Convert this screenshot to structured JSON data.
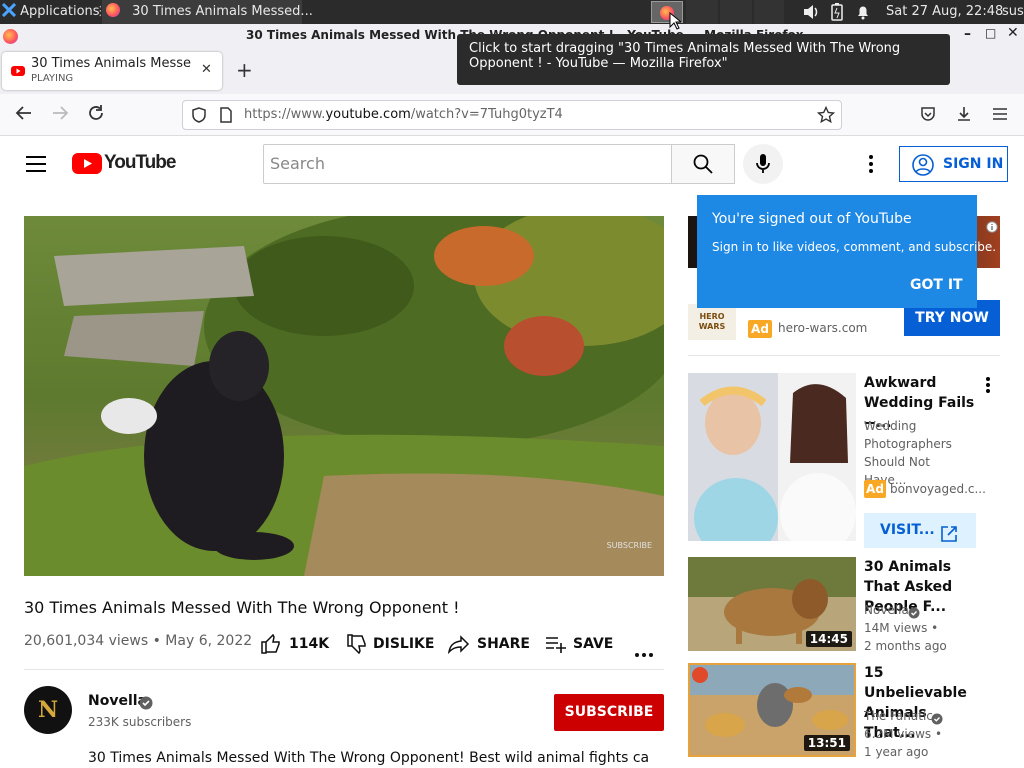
{
  "taskbar": {
    "apps_label": "Applications",
    "window_title": "30 Times Animals Messed...",
    "clock": "Sat 27 Aug, 22:48",
    "user": "sus"
  },
  "firefox": {
    "title": "30 Times Animals Messed With The Wrong Opponent ! - YouTube — Mozilla Firefox",
    "tab_title": "30 Times Animals Messed W",
    "tab_status": "PLAYING",
    "url_prefix": "https://www.",
    "url_domain": "youtube.com",
    "url_path": "/watch?v=7Tuhg0tyzT4",
    "tooltip": "Click to start dragging \"30 Times Animals Messed With The Wrong Opponent ! - YouTube — Mozilla Firefox\""
  },
  "yt": {
    "logo_text": "YouTube",
    "search_placeholder": "Search",
    "sign_in": "SIGN IN",
    "popup": {
      "title": "You're signed out of YouTube",
      "body": "Sign in to like videos, comment, and subscribe.",
      "button": "GOT IT"
    },
    "video": {
      "title": "30 Times Animals Messed With The Wrong Opponent !",
      "views_date": "20,601,034 views • May 6, 2022",
      "likes": "114K",
      "dislike": "DISLIKE",
      "share": "SHARE",
      "save": "SAVE",
      "watermark": "SUBSCRIBE"
    },
    "channel": {
      "name": "Novella",
      "subscribers": "233K subscribers",
      "subscribe": "SUBSCRIBE",
      "avatar_letter": "N"
    },
    "description": "30 Times Animals Messed With The Wrong Opponent! Best wild animal fights caught on",
    "ad": {
      "logo_text": "HERO WARS",
      "badge": "Ad",
      "domain": "hero-wars.com",
      "cta": "TRY NOW"
    },
    "sidebar": [
      {
        "title": "Awkward Wedding Fails --...",
        "desc": "Wedding Photographers Should Not Have...",
        "badge": "Ad",
        "domain": "bonvoyaged.c...",
        "cta": "VISIT..."
      },
      {
        "title": "30 Animals That Asked People F...",
        "channel": "Novella",
        "views": "14M views •",
        "age": "2 months ago",
        "duration": "14:45"
      },
      {
        "title": "15 Unbelievable Animals That...",
        "channel": "The Fanatic",
        "views": "6.2M views •",
        "age": "1 year ago",
        "duration": "13:51"
      }
    ]
  },
  "colors": {
    "youtube_red": "#ff0000",
    "subscribe_red": "#cc0000",
    "link_blue": "#065fd4",
    "popup_blue": "#1e88e5",
    "ad_yellow": "#f9a825"
  }
}
